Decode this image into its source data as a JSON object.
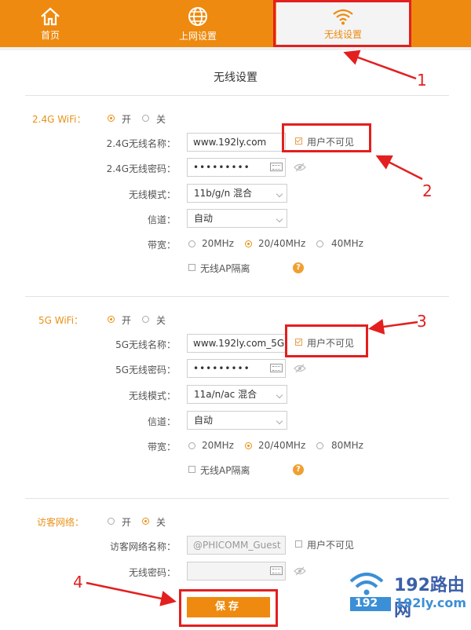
{
  "nav": {
    "items": [
      {
        "label": "首页",
        "icon": "home-icon"
      },
      {
        "label": "上网设置",
        "icon": "globe-icon"
      },
      {
        "label": "无线设置",
        "icon": "wifi-icon",
        "active": true
      }
    ]
  },
  "page_title": "无线设置",
  "wifi24": {
    "section_label": "2.4G WiFi：",
    "on_label": "开",
    "off_label": "关",
    "enabled": true,
    "name_label": "2.4G无线名称：",
    "name_value": "www.192ly.com",
    "hide_label": "用户不可见",
    "hide_checked": true,
    "pwd_label": "2.4G无线密码：",
    "pwd_value": "•••••••••",
    "mode_label": "无线模式：",
    "mode_value": "11b/g/n 混合",
    "channel_label": "信道：",
    "channel_value": "自动",
    "bw_label": "带宽：",
    "bw_options": [
      "20MHz",
      "20/40MHz",
      "40MHz"
    ],
    "bw_selected": "20/40MHz",
    "ap_isolation_label": "无线AP隔离",
    "help": "?"
  },
  "wifi5": {
    "section_label": "5G WiFi：",
    "on_label": "开",
    "off_label": "关",
    "enabled": true,
    "name_label": "5G无线名称：",
    "name_value": "www.192ly.com_5G",
    "hide_label": "用户不可见",
    "hide_checked": true,
    "pwd_label": "5G无线密码：",
    "pwd_value": "•••••••••",
    "mode_label": "无线模式：",
    "mode_value": "11a/n/ac 混合",
    "channel_label": "信道：",
    "channel_value": "自动",
    "bw_label": "带宽：",
    "bw_options": [
      "20MHz",
      "20/40MHz",
      "80MHz"
    ],
    "bw_selected": "20/40MHz",
    "ap_isolation_label": "无线AP隔离",
    "help": "?"
  },
  "guest": {
    "section_label": "访客网络：",
    "on_label": "开",
    "off_label": "关",
    "enabled": false,
    "name_label": "访客网络名称：",
    "name_value": "@PHICOMM_Guest",
    "hide_label": "用户不可见",
    "pwd_label": "无线密码："
  },
  "save_label": "保存",
  "annotations": [
    "1",
    "2",
    "3",
    "4"
  ],
  "watermark": {
    "text": "192路由网",
    "sub_left": "192",
    "sub_right": "192ly.com"
  },
  "colors": {
    "accent": "#ee8a0f",
    "annotation": "#e31f1f"
  }
}
